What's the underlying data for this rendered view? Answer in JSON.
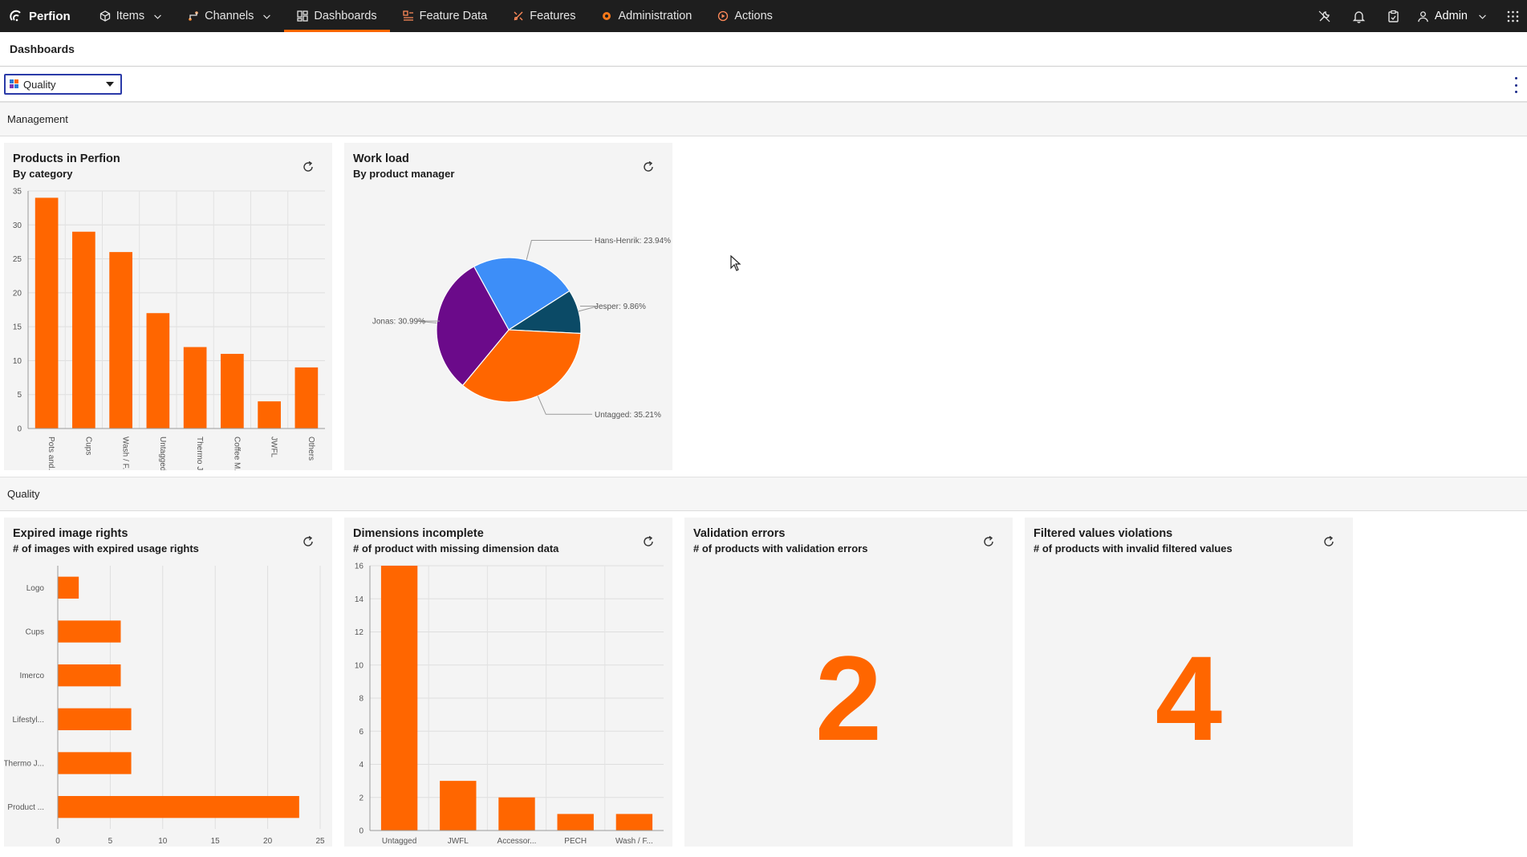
{
  "brand": {
    "name": "Perfion"
  },
  "nav": [
    {
      "label": "Items",
      "icon": "cube-icon",
      "dropdown": true,
      "active": false
    },
    {
      "label": "Channels",
      "icon": "channels-icon",
      "dropdown": true,
      "active": false
    },
    {
      "label": "Dashboards",
      "icon": "dashboard-icon",
      "dropdown": false,
      "active": true
    },
    {
      "label": "Feature Data",
      "icon": "feature-data-icon",
      "dropdown": false,
      "active": false
    },
    {
      "label": "Features",
      "icon": "features-icon",
      "dropdown": false,
      "active": false
    },
    {
      "label": "Administration",
      "icon": "gear-icon",
      "dropdown": false,
      "active": false
    },
    {
      "label": "Actions",
      "icon": "actions-icon",
      "dropdown": false,
      "active": false
    }
  ],
  "user": {
    "name": "Admin"
  },
  "page": {
    "title": "Dashboards"
  },
  "dashboard_select": {
    "value": "Quality"
  },
  "sections": {
    "management": "Management",
    "quality": "Quality"
  },
  "colors": {
    "accent": "#ff6600",
    "topbar": "#1e1e1e"
  },
  "widgets": {
    "products": {
      "title": "Products in Perfion",
      "subtitle": "By category"
    },
    "workload": {
      "title": "Work load",
      "subtitle": "By product manager"
    },
    "expired": {
      "title": "Expired image rights",
      "subtitle": "# of images with expired usage rights"
    },
    "dimensions": {
      "title": "Dimensions incomplete",
      "subtitle": "# of product with missing dimension data"
    },
    "validation": {
      "title": "Validation errors",
      "subtitle": "# of products with validation errors",
      "value": "2"
    },
    "filtered": {
      "title": "Filtered values violations",
      "subtitle": "# of products with invalid filtered values",
      "value": "4"
    }
  },
  "chart_data": [
    {
      "id": "products",
      "type": "bar",
      "categories": [
        "Pots and...",
        "Cups",
        "Wash / F...",
        "Untagged",
        "Thermo J...",
        "Coffee M...",
        "JWFL",
        "Others"
      ],
      "values": [
        34,
        29,
        26,
        17,
        12,
        11,
        4,
        9
      ],
      "ylim": [
        0,
        35
      ],
      "yticks": [
        0,
        5,
        10,
        15,
        20,
        25,
        30,
        35
      ],
      "grid": true,
      "color": "#ff6600"
    },
    {
      "id": "workload",
      "type": "pie",
      "slices": [
        {
          "label": "Hans-Henrik: 23.94%",
          "value": 23.94,
          "color": "#3d8ef8"
        },
        {
          "label": "Jesper: 9.86%",
          "value": 9.86,
          "color": "#0b4a66"
        },
        {
          "label": "Untagged: 35.21%",
          "value": 35.21,
          "color": "#ff6600"
        },
        {
          "label": "Jonas: 30.99%",
          "value": 30.99,
          "color": "#6b0a8a"
        }
      ]
    },
    {
      "id": "expired",
      "type": "bar",
      "orientation": "horizontal",
      "categories": [
        "Logo",
        "Cups",
        "Imerco",
        "Lifestyl...",
        "Thermo J...",
        "Product ..."
      ],
      "values": [
        2,
        6,
        6,
        7,
        7,
        23
      ],
      "xlim": [
        0,
        25
      ],
      "xticks": [
        0,
        5,
        10,
        15,
        20,
        25
      ],
      "grid": true,
      "color": "#ff6600"
    },
    {
      "id": "dimensions",
      "type": "bar",
      "categories": [
        "Untagged",
        "JWFL",
        "Accessor...",
        "PECH",
        "Wash / F..."
      ],
      "values": [
        16,
        3,
        2,
        1,
        1
      ],
      "ylim": [
        0,
        16
      ],
      "yticks": [
        0,
        2,
        4,
        6,
        8,
        10,
        12,
        14,
        16
      ],
      "grid": true,
      "color": "#ff6600"
    }
  ]
}
